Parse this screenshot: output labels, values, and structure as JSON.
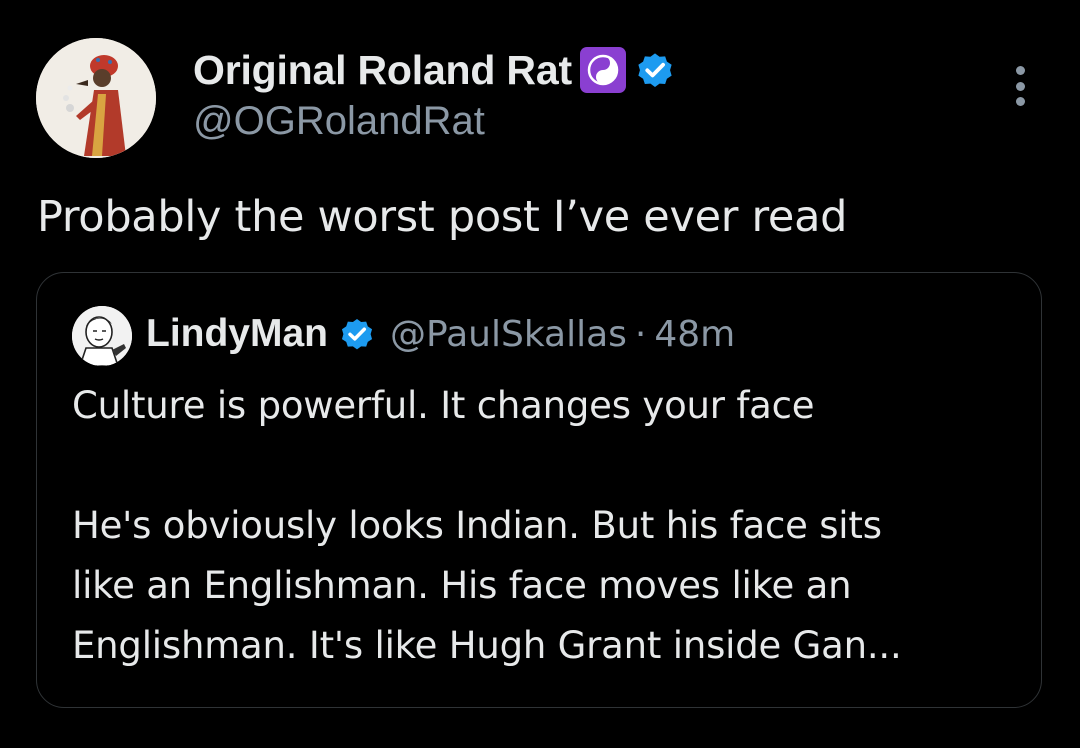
{
  "author": {
    "display_name": "Original Roland Rat",
    "handle": "@OGRolandRat",
    "badges": [
      "yin-yang-emoji",
      "verified-badge"
    ],
    "badge_colors": {
      "emoji_bg": "#8a3fd1",
      "verified": "#1d9bf0"
    }
  },
  "tweet": {
    "text": "Probably the worst post I’ve ever read"
  },
  "quoted": {
    "display_name": "LindyMan",
    "handle": "@PaulSkallas",
    "separator": "·",
    "time": "48m",
    "lines": [
      "Culture is powerful. It changes your face",
      "He's obviously looks Indian. But his face sits",
      "like an Englishman. His face moves like an",
      "Englishman. It's like Hugh Grant inside Gan..."
    ]
  },
  "theme": {
    "background": "#000000",
    "text_primary": "#e7e9ea",
    "text_secondary": "#8b98a5",
    "border": "#2f3336"
  },
  "icons": {
    "more": "more-vertical-icon",
    "verified": "verified-icon",
    "yinyang": "yin-yang-icon"
  }
}
